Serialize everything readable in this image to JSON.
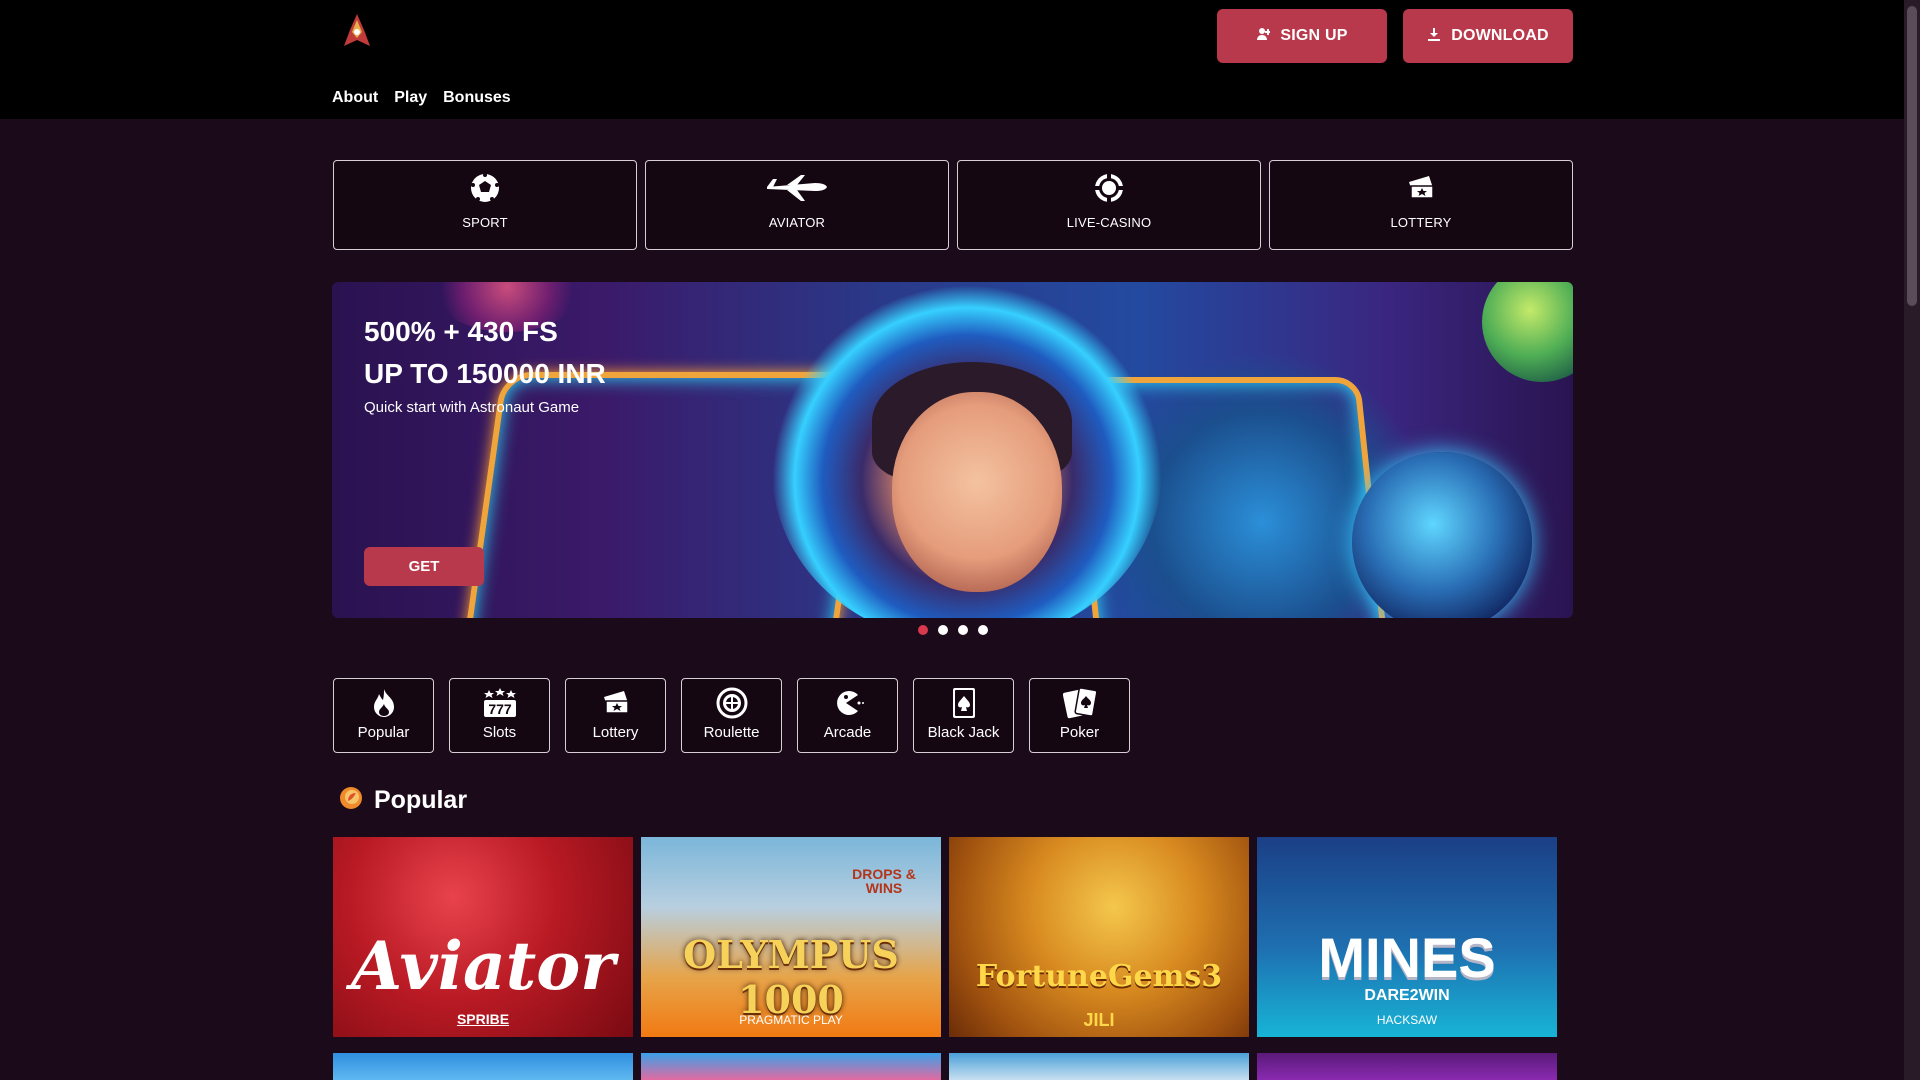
{
  "header": {
    "signup_label": "SIGN UP",
    "download_label": "DOWNLOAD",
    "nav": [
      "About",
      "Play",
      "Bonuses"
    ]
  },
  "categories": [
    {
      "label": "SPORT",
      "icon": "soccer-ball-icon"
    },
    {
      "label": "AVIATOR",
      "icon": "airplane-icon"
    },
    {
      "label": "LIVE-CASINO",
      "icon": "casino-chip-icon"
    },
    {
      "label": "LOTTERY",
      "icon": "lottery-ticket-icon"
    }
  ],
  "banner": {
    "line1": "500% + 430 FS",
    "line2": "UP TO 150000 INR",
    "subtitle": "Quick start with Astronaut Game",
    "cta": "GET",
    "slides": 4,
    "active_slide": 1
  },
  "game_types": [
    {
      "label": "Popular",
      "icon": "fire-icon"
    },
    {
      "label": "Slots",
      "icon": "slots-777-icon"
    },
    {
      "label": "Lottery",
      "icon": "lottery-ticket-icon"
    },
    {
      "label": "Roulette",
      "icon": "roulette-icon"
    },
    {
      "label": "Arcade",
      "icon": "pacman-icon"
    },
    {
      "label": "Black Jack",
      "icon": "playing-card-icon"
    },
    {
      "label": "Poker",
      "icon": "poker-cards-icon"
    }
  ],
  "popular": {
    "title": "Popular",
    "games": [
      {
        "title": "Aviator",
        "provider": "SPRIBE"
      },
      {
        "title": "OLYMPUS 1000",
        "badge": "DROPS & WINS",
        "provider": "PRAGMATIC PLAY"
      },
      {
        "title": "FortuneGems3",
        "provider": "JILI"
      },
      {
        "title": "MINES",
        "subtitle": "DARE2WIN",
        "provider": "HACKSAW"
      }
    ]
  },
  "colors": {
    "accent": "#b8394b",
    "background": "#1b0a19",
    "header": "#000000",
    "dot_active": "#d8394c"
  }
}
